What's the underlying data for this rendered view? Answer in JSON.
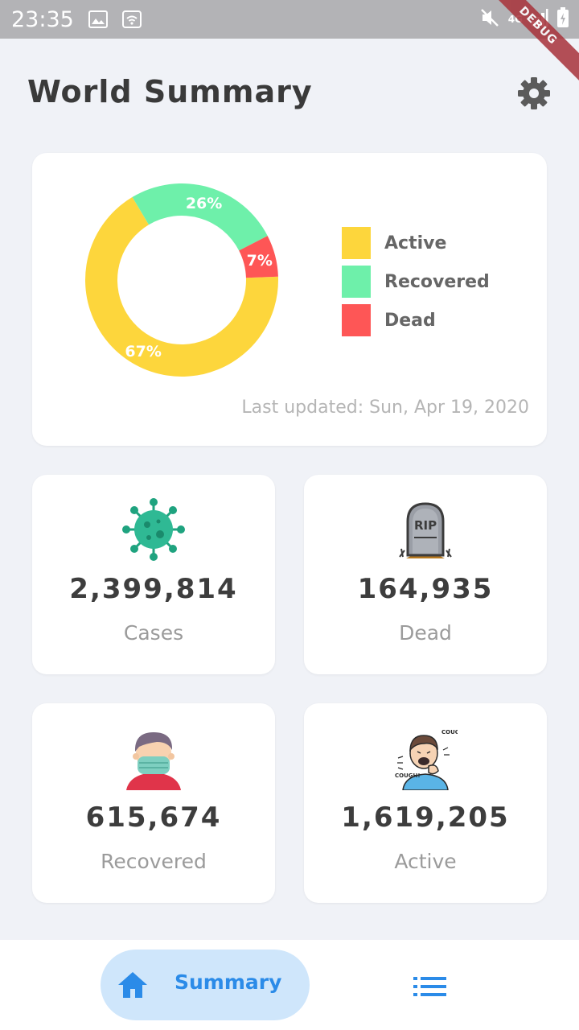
{
  "status_bar": {
    "time": "23:35",
    "network": "4G"
  },
  "debug_banner": "DEBUG",
  "header": {
    "title": "World Summary",
    "settings_icon": "gear-icon"
  },
  "chart_data": {
    "type": "pie",
    "labels": [
      "Active",
      "Recovered",
      "Dead"
    ],
    "values": [
      67,
      26,
      7
    ],
    "value_labels": [
      "67%",
      "26%",
      "7%"
    ],
    "colors": [
      "#fdd63c",
      "#6ef0aa",
      "#fe5656"
    ],
    "donut": true,
    "legend": "right"
  },
  "summary": {
    "last_updated": "Last updated: Sun, Apr 19, 2020"
  },
  "stats": {
    "cases": {
      "value": "2,399,814",
      "label": "Cases",
      "icon": "virus-icon"
    },
    "dead": {
      "value": "164,935",
      "label": "Dead",
      "icon": "tombstone-icon"
    },
    "recovered": {
      "value": "615,674",
      "label": "Recovered",
      "icon": "masked-person-icon"
    },
    "active": {
      "value": "1,619,205",
      "label": "Active",
      "icon": "coughing-person-icon"
    }
  },
  "bottom_nav": {
    "summary_label": "Summary",
    "home_icon": "home-icon",
    "list_icon": "list-icon"
  },
  "colors": {
    "accent": "#2b8be8",
    "active_pill": "#cfe6fb",
    "background": "#f0f2f7"
  }
}
